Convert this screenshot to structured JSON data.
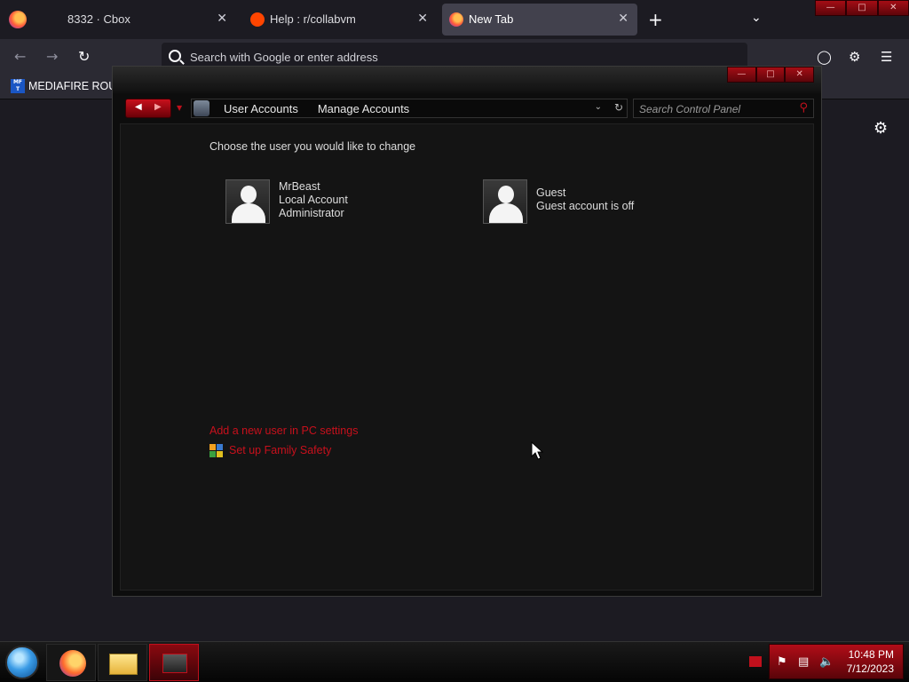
{
  "browser": {
    "tabs": [
      {
        "label": "8332 · Cbox",
        "active": false
      },
      {
        "label": "Help : r/collabvm",
        "active": false
      },
      {
        "label": "New Tab",
        "active": true
      }
    ],
    "new_tab_symbol": "+",
    "tab_close_symbol": "✕",
    "url_placeholder": "Search with Google or enter address",
    "bookmark_label": "MEDIAFIRE ROULI",
    "bookmark_icon_text": "MF T"
  },
  "control_panel": {
    "breadcrumb": [
      "User Accounts",
      "Manage Accounts"
    ],
    "search_placeholder": "Search Control Panel",
    "heading": "Choose the user you would like to change",
    "accounts": [
      {
        "name": "MrBeast",
        "line2": "Local Account",
        "line3": "Administrator"
      },
      {
        "name": "Guest",
        "line2": "Guest account is off"
      }
    ],
    "links": {
      "add_user": "Add a new user in PC settings",
      "family_safety": "Set up Family Safety"
    }
  },
  "taskbar": {
    "time": "10:48 PM",
    "date": "7/12/2023"
  },
  "colors": {
    "accent_red": "#c8101c",
    "browser_bg": "#1c1b22",
    "toolbar_bg": "#2b2a33"
  }
}
